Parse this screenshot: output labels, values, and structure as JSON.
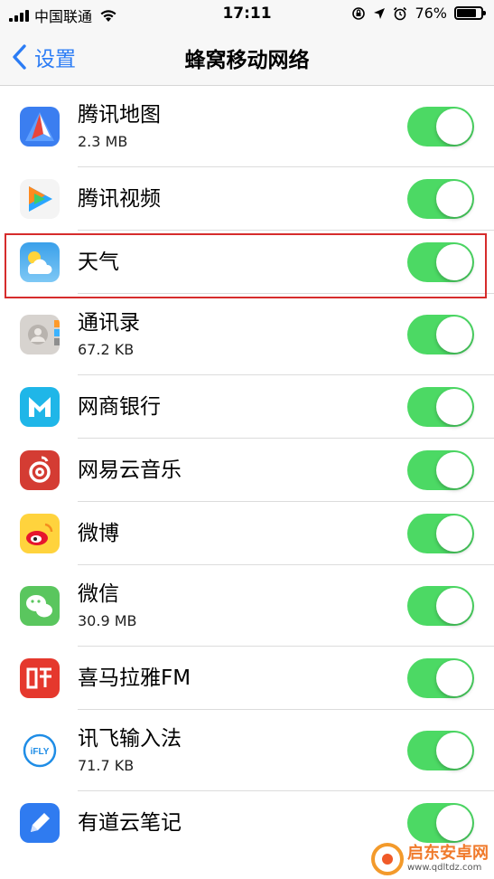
{
  "status_bar": {
    "carrier": "中国联通",
    "time": "17:11",
    "battery_percent": "76%",
    "battery_level": 0.76
  },
  "nav": {
    "back_label": "设置",
    "title": "蜂窝移动网络"
  },
  "apps": [
    {
      "name": "腾讯地图",
      "size": "2.3 MB",
      "icon": "tencent-map-icon",
      "enabled": true
    },
    {
      "name": "腾讯视频",
      "size": "",
      "icon": "tencent-video-icon",
      "enabled": true
    },
    {
      "name": "天气",
      "size": "",
      "icon": "weather-icon",
      "enabled": true
    },
    {
      "name": "通讯录",
      "size": "67.2 KB",
      "icon": "contacts-icon",
      "enabled": true
    },
    {
      "name": "网商银行",
      "size": "",
      "icon": "mybank-icon",
      "enabled": true
    },
    {
      "name": "网易云音乐",
      "size": "",
      "icon": "netease-music-icon",
      "enabled": true
    },
    {
      "name": "微博",
      "size": "",
      "icon": "weibo-icon",
      "enabled": true
    },
    {
      "name": "微信",
      "size": "30.9 MB",
      "icon": "wechat-icon",
      "enabled": true
    },
    {
      "name": "喜马拉雅FM",
      "size": "",
      "icon": "ximalaya-icon",
      "enabled": true
    },
    {
      "name": "讯飞输入法",
      "size": "71.7 KB",
      "icon": "ifly-input-icon",
      "enabled": true
    },
    {
      "name": "有道云笔记",
      "size": "",
      "icon": "youdao-note-icon",
      "enabled": true
    }
  ],
  "watermark": {
    "title": "启东安卓网",
    "url": "www.qdltdz.com"
  },
  "colors": {
    "accent": "#2b7cf5",
    "toggle_on": "#4cd964",
    "highlight": "#d62c2c"
  }
}
